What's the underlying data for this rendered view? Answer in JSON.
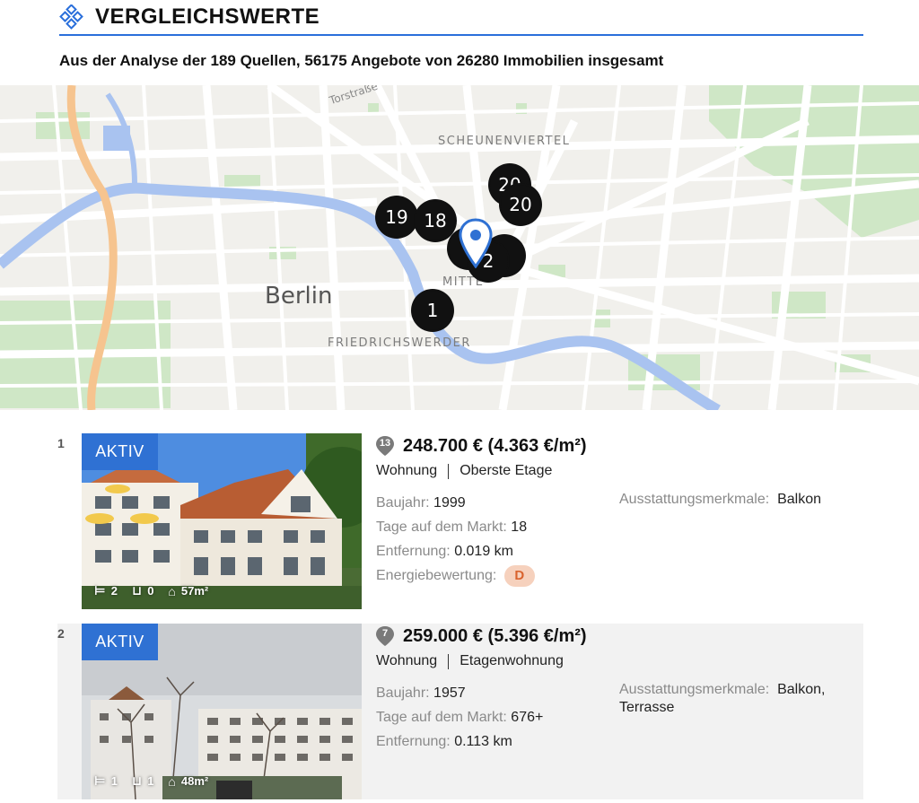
{
  "header": {
    "title": "VERGLEICHSWERTE",
    "subtitle": "Aus der Analyse der 189 Quellen, 56175 Angebote von 26280 Immobilien insgesamt",
    "accent_color": "#2a6fdb",
    "logo_icon": "diamond-cluster-icon"
  },
  "map": {
    "city_label": "Berlin",
    "district_labels": [
      "SCHEUNENVIERTEL",
      "MITTE",
      "FRIEDRICHSWERDER"
    ],
    "street_label": "Torstraße",
    "clusters": [
      "19",
      "18",
      "20",
      "20",
      "2",
      "1"
    ],
    "selected_pin_icon": "location-pin-icon"
  },
  "listings": [
    {
      "number": "1",
      "status": "AKTIV",
      "rank": "13",
      "price": "248.700 € (4.363 €/m²)",
      "type": "Wohnung",
      "subtype": "Oberste Etage",
      "stats": {
        "rooms": "2",
        "baths": "0",
        "area": "57m²"
      },
      "facts": [
        {
          "label": "Baujahr:",
          "value": "1999"
        },
        {
          "label": "Tage auf dem Markt:",
          "value": "18"
        },
        {
          "label": "Entfernung:",
          "value": "0.019 km"
        },
        {
          "label": "Energiebewertung:",
          "value": "D"
        }
      ],
      "features_label": "Ausstattungsmerkmale:",
      "features_value": "Balkon"
    },
    {
      "number": "2",
      "status": "AKTIV",
      "rank": "7",
      "price": "259.000 € (5.396 €/m²)",
      "type": "Wohnung",
      "subtype": "Etagenwohnung",
      "stats": {
        "rooms": "1",
        "baths": "1",
        "area": "48m²"
      },
      "facts": [
        {
          "label": "Baujahr:",
          "value": "1957"
        },
        {
          "label": "Tage auf dem Markt:",
          "value": "676+"
        },
        {
          "label": "Entfernung:",
          "value": "0.113 km"
        }
      ],
      "features_label": "Ausstattungsmerkmale:",
      "features_value": "Balkon,",
      "features_value_2": "Terrasse"
    }
  ],
  "colors": {
    "badge": "#2f71d3",
    "energy_bg": "#f6d1bd",
    "energy_text": "#d9632e",
    "marker": "#7a7a7a"
  }
}
